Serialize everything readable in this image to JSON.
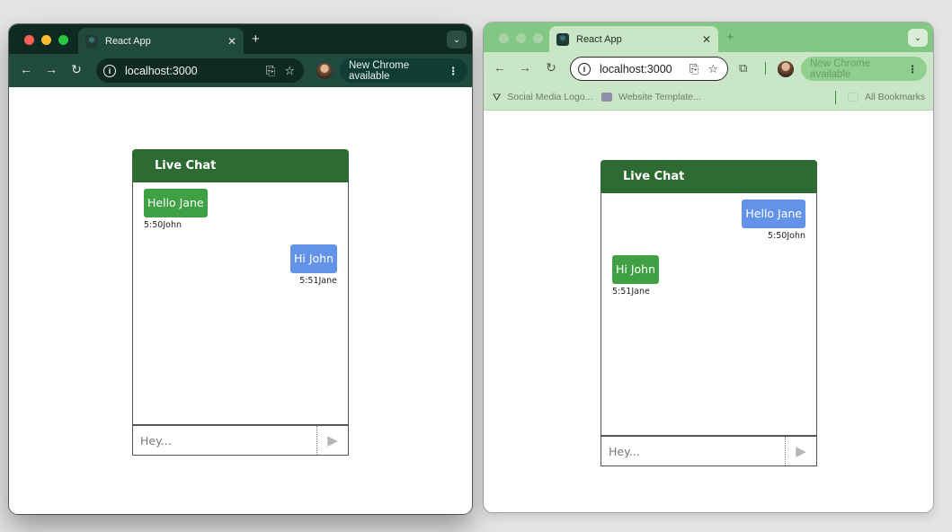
{
  "windows": {
    "left": {
      "tab_title": "React App",
      "url": "localhost:3000",
      "update_label": "New Chrome available",
      "chat": {
        "header": "Live Chat",
        "messages": [
          {
            "text": "Hello Jane",
            "time": "5:50",
            "sender": "John",
            "align": "left",
            "color": "green"
          },
          {
            "text": "Hi John",
            "time": "5:51",
            "sender": "Jane",
            "align": "right",
            "color": "blue"
          }
        ],
        "input_placeholder": "Hey...",
        "send_icon": "send-icon"
      }
    },
    "right": {
      "tab_title": "React App",
      "url": "localhost:3000",
      "update_label": "New Chrome available",
      "bookmarks": [
        {
          "label": "Social Media Logo...",
          "icon": "bookmark-favicon-icon"
        },
        {
          "label": "Website Template...",
          "icon": "bookmark-favicon-icon"
        }
      ],
      "all_bookmarks_label": "All Bookmarks",
      "chat": {
        "header": "Live Chat",
        "messages": [
          {
            "text": "Hello Jane",
            "time": "5:50",
            "sender": "John",
            "align": "right",
            "color": "blue"
          },
          {
            "text": "Hi John",
            "time": "5:51",
            "sender": "Jane",
            "align": "left",
            "color": "green"
          }
        ],
        "input_placeholder": "Hey...",
        "send_icon": "send-icon"
      }
    }
  },
  "colors": {
    "chat_header": "#2e6b33",
    "bubble_green": "#3fa143",
    "bubble_blue": "#6393e8",
    "left_theme_frame": "#0f2a22",
    "right_theme_frame": "#82c784"
  }
}
